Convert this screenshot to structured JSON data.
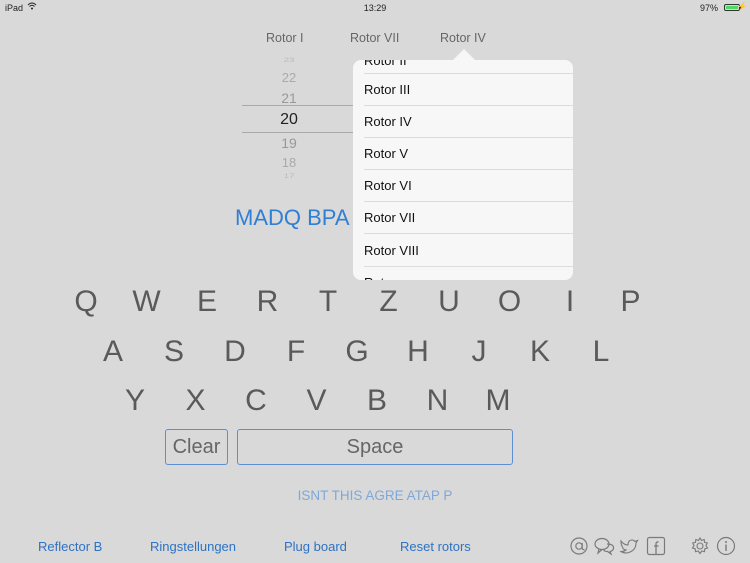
{
  "status_bar": {
    "carrier": "iPad",
    "wifi_icon": "wifi-icon",
    "time": "13:29",
    "battery_percent": "97%",
    "battery_level": 0.97,
    "charging_icon": "bolt-icon"
  },
  "rotors": {
    "labels": [
      "Rotor I",
      "Rotor VII",
      "Rotor IV"
    ]
  },
  "picker": {
    "values": [
      "23",
      "22",
      "21",
      "20",
      "19",
      "18",
      "17"
    ],
    "selected": "20"
  },
  "popover": {
    "items": [
      "Rotor II",
      "Rotor III",
      "Rotor IV",
      "Rotor V",
      "Rotor VI",
      "Rotor VII",
      "Rotor VIII",
      "Rotor"
    ]
  },
  "cipher_output": "MADQ BPA",
  "keyboard": {
    "row1": [
      "Q",
      "W",
      "E",
      "R",
      "T",
      "Z",
      "U",
      "O",
      "I",
      "P"
    ],
    "row2": [
      "A",
      "S",
      "D",
      "F",
      "G",
      "H",
      "J",
      "K",
      "L"
    ],
    "row3": [
      "Y",
      "X",
      "C",
      "V",
      "B",
      "N",
      "M"
    ],
    "clear_label": "Clear",
    "space_label": "Space"
  },
  "plain_output": "ISNT THIS AGRE ATAP P",
  "bottom_bar": {
    "links": [
      "Reflector B",
      "Ringstellungen",
      "Plug board",
      "Reset rotors"
    ],
    "icons": [
      "at-icon",
      "chat-bubbles-icon",
      "twitter-icon",
      "facebook-icon",
      "gear-icon",
      "info-icon"
    ]
  },
  "colors": {
    "background": "#d9d9d9",
    "accent": "#2d72c4",
    "popover": "#f7f7f7",
    "battery": "#4cd964"
  }
}
